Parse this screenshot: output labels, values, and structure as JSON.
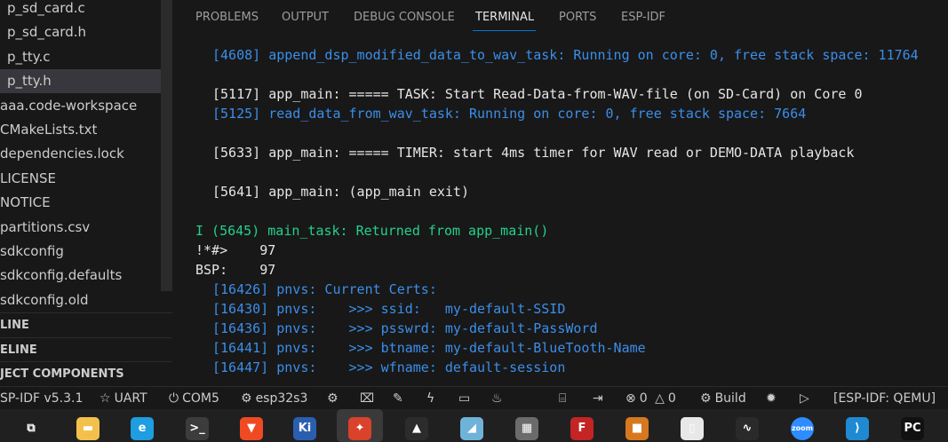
{
  "explorer": {
    "files": [
      {
        "label": "p_sd_card.c",
        "indent": 8,
        "active": false
      },
      {
        "label": "p_sd_card.h",
        "indent": 8,
        "active": false
      },
      {
        "label": "p_tty.c",
        "indent": 8,
        "active": false
      },
      {
        "label": "p_tty.h",
        "indent": 8,
        "active": true
      },
      {
        "label": "aaa.code-workspace",
        "indent": 0,
        "active": false
      },
      {
        "label": "CMakeLists.txt",
        "indent": 0,
        "active": false
      },
      {
        "label": "dependencies.lock",
        "indent": 0,
        "active": false
      },
      {
        "label": "LICENSE",
        "indent": 0,
        "active": false
      },
      {
        "label": "NOTICE",
        "indent": 0,
        "active": false
      },
      {
        "label": "partitions.csv",
        "indent": 0,
        "active": false
      },
      {
        "label": "sdkconfig",
        "indent": 0,
        "active": false
      },
      {
        "label": "sdkconfig.defaults",
        "indent": 0,
        "active": false
      },
      {
        "label": "sdkconfig.old",
        "indent": 0,
        "active": false
      }
    ],
    "sections": [
      "LINE",
      "ELINE",
      "JECT COMPONENTS"
    ]
  },
  "panel": {
    "tabs": [
      {
        "label": "PROBLEMS",
        "active": false
      },
      {
        "label": "OUTPUT",
        "active": false
      },
      {
        "label": "DEBUG CONSOLE",
        "active": false
      },
      {
        "label": "TERMINAL",
        "active": true
      },
      {
        "label": "PORTS",
        "active": false
      },
      {
        "label": "ESP-IDF",
        "active": false
      }
    ]
  },
  "terminal": {
    "lines": [
      {
        "text": "[4608] append_dsp_modified_data_to_wav_task: Running on core: 0, free stack space: 11764",
        "color": "blue",
        "indent": 1
      },
      {
        "text": "",
        "color": "white",
        "indent": 0
      },
      {
        "text": "[5117] app_main: ===== TASK: Start Read-Data-from-WAV-file (on SD-Card) on Core 0",
        "color": "white",
        "indent": 1
      },
      {
        "text": "[5125] read_data_from_wav_task: Running on core: 0, free stack space: 7664",
        "color": "blue",
        "indent": 1
      },
      {
        "text": "",
        "color": "white",
        "indent": 0
      },
      {
        "text": "[5633] app_main: ===== TIMER: start 4ms timer for WAV read or DEMO-DATA playback",
        "color": "white",
        "indent": 1
      },
      {
        "text": "",
        "color": "white",
        "indent": 0
      },
      {
        "text": "[5641] app_main: (app_main exit)",
        "color": "white",
        "indent": 1
      },
      {
        "text": "",
        "color": "white",
        "indent": 0
      },
      {
        "text": "I (5645) main_task: Returned from app_main()",
        "color": "green",
        "indent": 0
      },
      {
        "text": "!*#>    97",
        "color": "white",
        "indent": 0
      },
      {
        "text": "BSP:    97",
        "color": "white",
        "indent": 0
      },
      {
        "text": "[16426] pnvs: Current Certs:",
        "color": "blue",
        "indent": 1
      },
      {
        "text": "[16430] pnvs:    >>> ssid:   my-default-SSID",
        "color": "blue",
        "indent": 1
      },
      {
        "text": "[16436] pnvs:    >>> psswrd: my-default-PassWord",
        "color": "blue",
        "indent": 1
      },
      {
        "text": "[16441] pnvs:    >>> btname: my-default-BlueTooth-Name",
        "color": "blue",
        "indent": 1
      },
      {
        "text": "[16447] pnvs:    >>> wfname: default-session",
        "color": "blue",
        "indent": 1
      }
    ]
  },
  "statusbar": {
    "idf_version": "SP-IDF v5.3.1",
    "uart_label": "UART",
    "port_label": "COM5",
    "target_label": "esp32s3",
    "errors": "0",
    "warnings": "0",
    "build_label": "Build",
    "qemu_label": "[ESP-IDF: QEMU]"
  },
  "taskbar": {
    "apps": [
      {
        "name": "task-view",
        "glyph": "⧉",
        "color": "#202020"
      },
      {
        "name": "file-explorer",
        "glyph": "▬",
        "color": "#f3c14b"
      },
      {
        "name": "edge",
        "glyph": "e",
        "color": "#1e9de0"
      },
      {
        "name": "terminal",
        "glyph": ">_",
        "color": "#3c3c3c"
      },
      {
        "name": "brave",
        "glyph": "▼",
        "color": "#f04a23"
      },
      {
        "name": "kicad",
        "glyph": "Ki",
        "color": "#2a5fb0"
      },
      {
        "name": "app-red",
        "glyph": "✦",
        "color": "#d9422b"
      },
      {
        "name": "inkscape",
        "glyph": "▲",
        "color": "#2c2c2c"
      },
      {
        "name": "notes",
        "glyph": "◢",
        "color": "#6fb3d9"
      },
      {
        "name": "calculator",
        "glyph": "▦",
        "color": "#6b6b6b"
      },
      {
        "name": "foxit",
        "glyph": "F",
        "color": "#c42424"
      },
      {
        "name": "box-app",
        "glyph": "■",
        "color": "#d7781f"
      },
      {
        "name": "sd-card-tool",
        "glyph": "▯",
        "color": "#e8e8e8"
      },
      {
        "name": "audio-app",
        "glyph": "∿",
        "color": "#2a2a2a"
      },
      {
        "name": "zoom",
        "glyph": "zoom",
        "color": "#2d8cff"
      },
      {
        "name": "vscode",
        "glyph": "⟩",
        "color": "#1f8ad2"
      },
      {
        "name": "pycharm",
        "glyph": "PC",
        "color": "#111111"
      }
    ]
  }
}
